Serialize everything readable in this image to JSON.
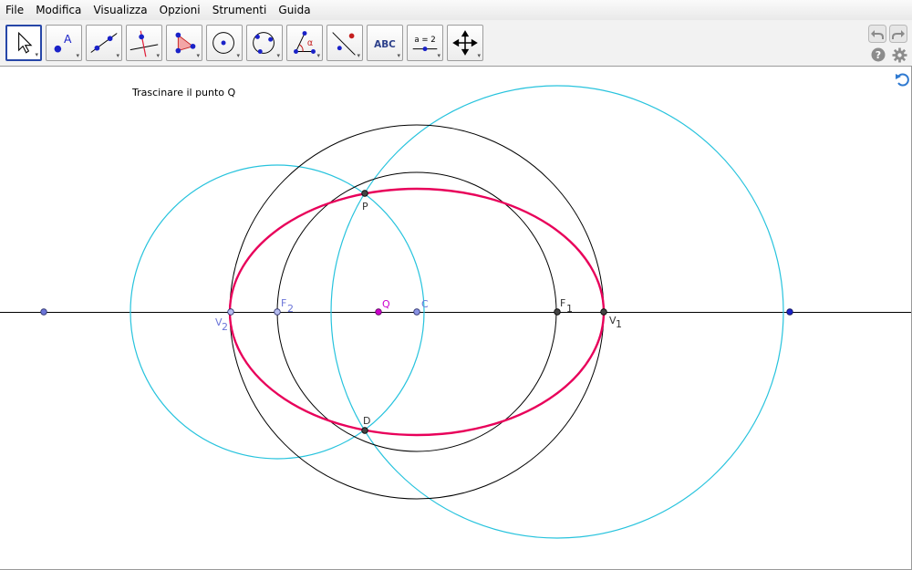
{
  "menu": [
    "File",
    "Modifica",
    "Visualizza",
    "Opzioni",
    "Strumenti",
    "Guida"
  ],
  "toolbar": {
    "tools": [
      {
        "icon": "move-arrow-icon",
        "selected": true
      },
      {
        "icon": "new-point-icon"
      },
      {
        "icon": "line-through-two-points-icon"
      },
      {
        "icon": "perpendicular-line-icon"
      },
      {
        "icon": "polygon-icon"
      },
      {
        "icon": "circle-center-point-icon"
      },
      {
        "icon": "circle-three-points-icon"
      },
      {
        "icon": "angle-icon"
      },
      {
        "icon": "reflect-about-line-icon"
      },
      {
        "icon": "text-icon"
      },
      {
        "icon": "slider-icon"
      },
      {
        "icon": "move-graphics-view-icon"
      }
    ],
    "text_tool_label": "ABC",
    "slider_tool_label": "a = 2",
    "angle_symbol": "α"
  },
  "canvas": {
    "instruction": "Trascinare il punto Q",
    "labels": {
      "p": "P",
      "d": "D",
      "q": "Q",
      "c": "C",
      "f1": "F",
      "f1_sub": "1",
      "f2": "F",
      "f2_sub": "2",
      "v1": "V",
      "v1_sub": "1",
      "v2": "V",
      "v2_sub": "2"
    }
  },
  "colors": {
    "ellipse": "#e8005a",
    "aux_circles": "#27c3dd",
    "black_circles": "#000000",
    "point_blue": "#6b75d8",
    "point_q": "#cc00cc",
    "toolbar_selected_border": "#2747a8"
  }
}
